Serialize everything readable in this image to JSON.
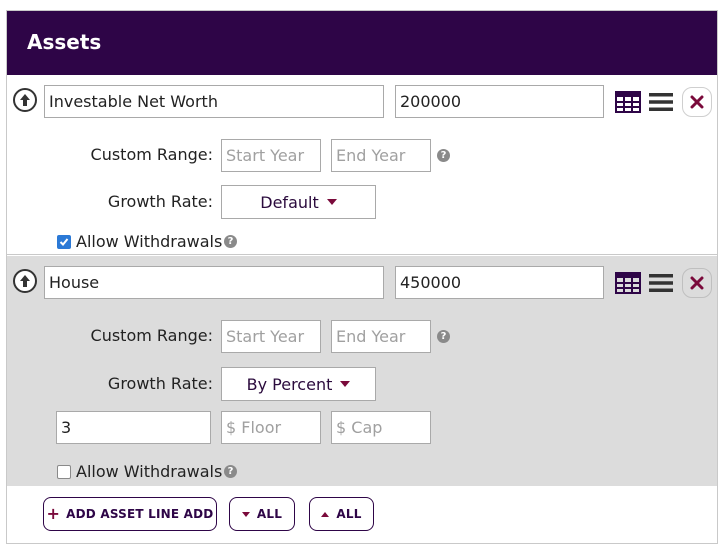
{
  "panel": {
    "title": "Assets"
  },
  "assets": [
    {
      "name": "Investable Net Worth",
      "value": "200000",
      "custom_range_label": "Custom Range:",
      "start_year_placeholder": "Start Year",
      "end_year_placeholder": "End Year",
      "growth_rate_label": "Growth Rate:",
      "growth_rate_value": "Default",
      "allow_withdrawals_label": "Allow Withdrawals",
      "allow_withdrawals_checked": true
    },
    {
      "name": "House",
      "value": "450000",
      "custom_range_label": "Custom Range:",
      "start_year_placeholder": "Start Year",
      "end_year_placeholder": "End Year",
      "growth_rate_label": "Growth Rate:",
      "growth_rate_value": "By Percent",
      "percent_value": "3",
      "floor_placeholder": "$ Floor",
      "cap_placeholder": "$ Cap",
      "allow_withdrawals_label": "Allow Withdrawals",
      "allow_withdrawals_checked": false
    }
  ],
  "footer": {
    "add_asset_label": "ADD ASSET LINE ADD",
    "collapse_all_label": "ALL",
    "expand_all_label": "ALL"
  },
  "icons": {
    "move_up": "arrow-up-circle-icon",
    "table": "table-icon",
    "menu": "hamburger-menu-icon",
    "remove": "close-icon",
    "help": "question-circle-icon"
  },
  "colors": {
    "header_bg": "#2e0547",
    "accent": "#7a0a3b",
    "checkbox_blue": "#2b79d6",
    "alt_row_bg": "#dcdcdc"
  }
}
